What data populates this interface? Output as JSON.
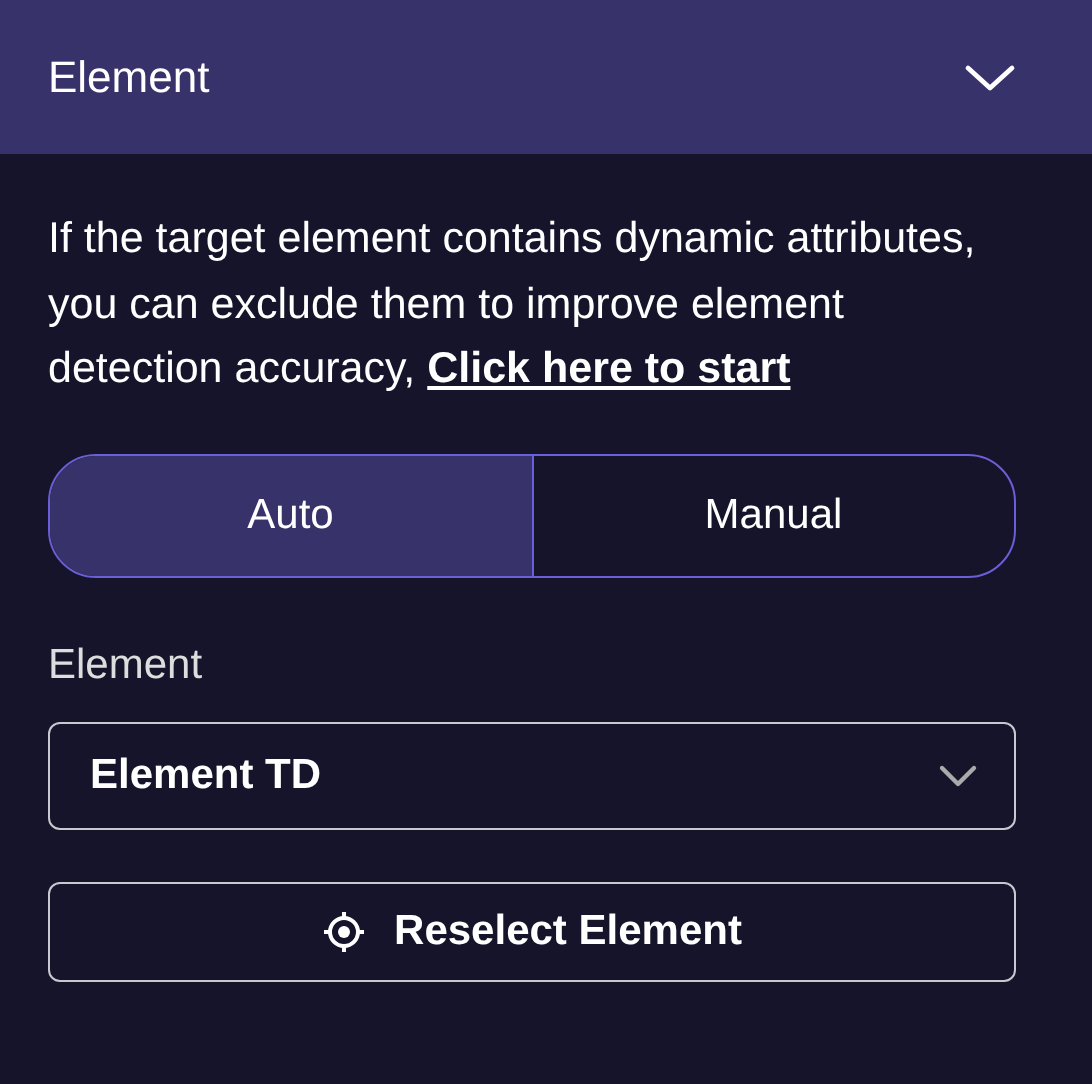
{
  "header": {
    "title": "Element",
    "expanded": true
  },
  "description": {
    "text": "If the target element contains dynamic attributes, you can exclude them to improve element detection accuracy, ",
    "link": "Click here to start"
  },
  "mode_tabs": [
    {
      "label": "Auto",
      "selected": true
    },
    {
      "label": "Manual",
      "selected": false
    }
  ],
  "element_field": {
    "label": "Element",
    "value": "Element TD"
  },
  "reselect_button": {
    "label": "Reselect Element"
  }
}
